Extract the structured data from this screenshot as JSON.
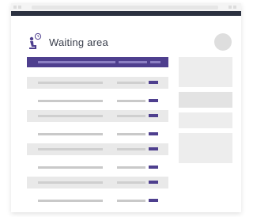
{
  "window": {
    "title": "Waiting area"
  },
  "header": {
    "icon": "waiting-person-icon"
  },
  "profile": {
    "icon": "avatar"
  },
  "table": {
    "rows": [
      {
        "shaded": true
      },
      {
        "shaded": false
      },
      {
        "shaded": true
      },
      {
        "shaded": false
      },
      {
        "shaded": true
      },
      {
        "shaded": false
      },
      {
        "shaded": true
      },
      {
        "shaded": false
      }
    ]
  },
  "colors": {
    "accent": "#4e3f8e",
    "header_strip": "#2b3140",
    "row_shaded": "#e9e9e9",
    "panel": "#ededed"
  }
}
